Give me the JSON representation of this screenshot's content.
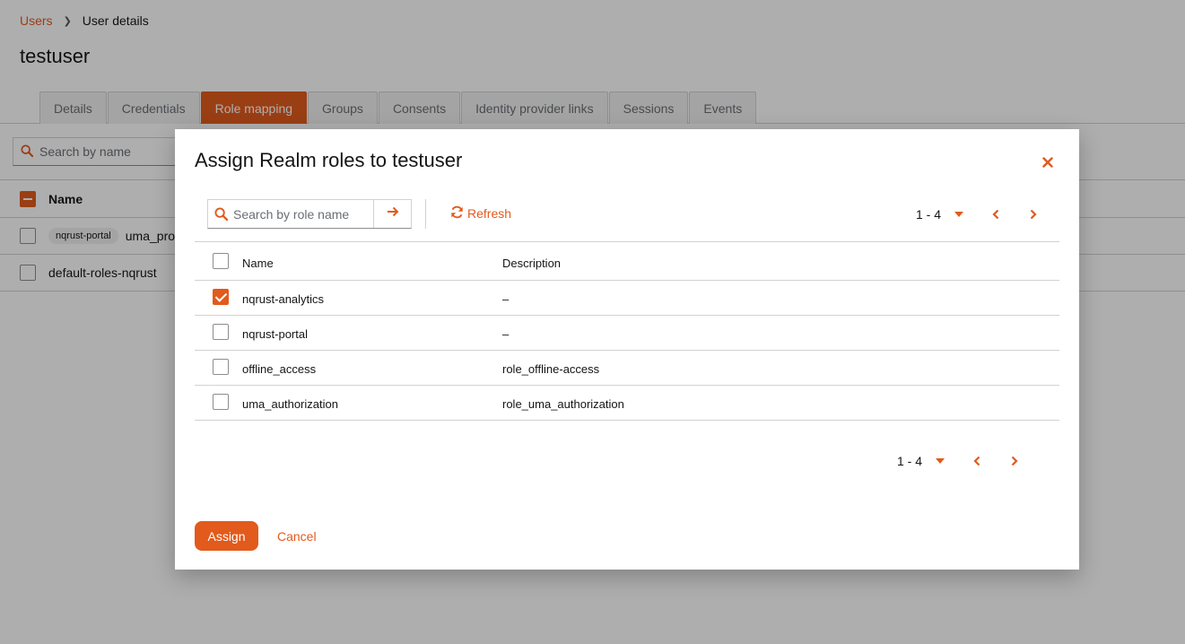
{
  "breadcrumb": {
    "parent": "Users",
    "current": "User details"
  },
  "page": {
    "title": "testuser"
  },
  "tabs": [
    {
      "label": "Details",
      "active": false
    },
    {
      "label": "Credentials",
      "active": false
    },
    {
      "label": "Role mapping",
      "active": true
    },
    {
      "label": "Groups",
      "active": false
    },
    {
      "label": "Consents",
      "active": false
    },
    {
      "label": "Identity provider links",
      "active": false
    },
    {
      "label": "Sessions",
      "active": false
    },
    {
      "label": "Events",
      "active": false
    }
  ],
  "background_table": {
    "search_placeholder": "Search by name",
    "header_name": "Name",
    "rows": [
      {
        "chip": "nqrust-portal",
        "name": "uma_prot"
      },
      {
        "chip": "",
        "name": "default-roles-nqrust"
      }
    ]
  },
  "modal": {
    "title": "Assign Realm roles to testuser",
    "search_placeholder": "Search by role name",
    "refresh_label": "Refresh",
    "pagination_range": "1 - 4",
    "columns": {
      "name": "Name",
      "description": "Description"
    },
    "rows": [
      {
        "name": "nqrust-analytics",
        "description": "–",
        "checked": true
      },
      {
        "name": "nqrust-portal",
        "description": "–",
        "checked": false
      },
      {
        "name": "offline_access",
        "description": "role_offline-access",
        "checked": false
      },
      {
        "name": "uma_authorization",
        "description": "role_uma_authorization",
        "checked": false
      }
    ],
    "assign_label": "Assign",
    "cancel_label": "Cancel"
  },
  "colors": {
    "accent": "#e25a1c",
    "border": "#d2d2d2",
    "text": "#151515",
    "muted": "#6a6e73"
  },
  "icons": {
    "search": "search-icon",
    "go": "arrow-right-icon",
    "refresh": "refresh-icon",
    "close": "close-icon",
    "caret": "caret-down-icon",
    "prev": "chevron-left-icon",
    "next": "chevron-right-icon"
  }
}
